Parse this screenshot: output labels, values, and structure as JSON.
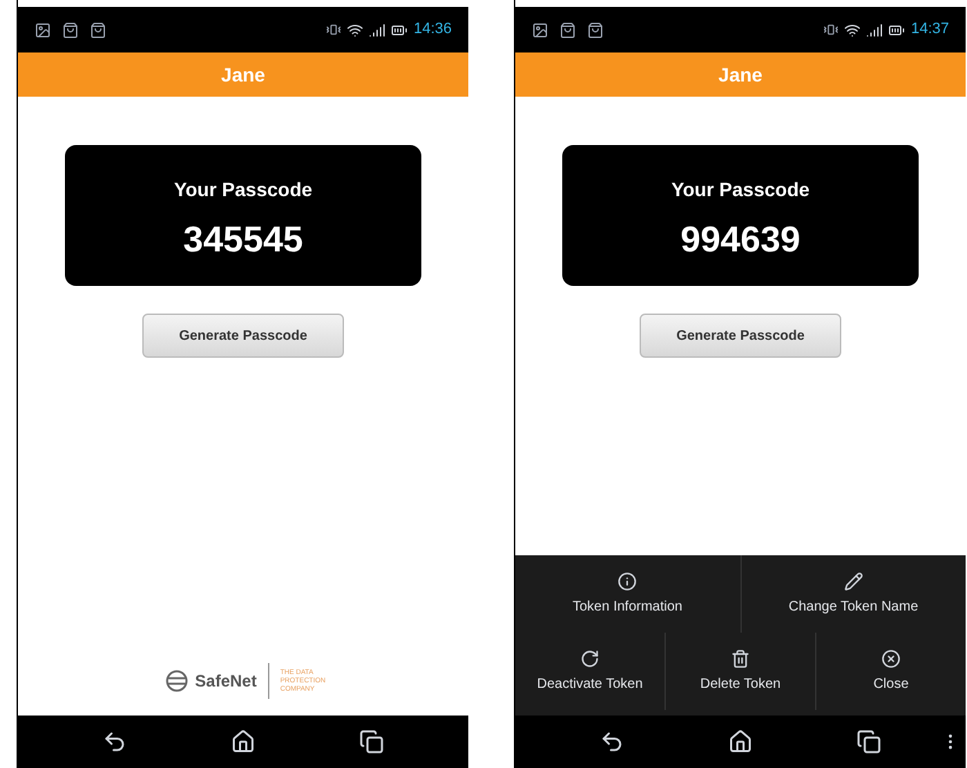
{
  "phones": [
    {
      "status_time": "14:36",
      "title": "Jane",
      "passcode_label": "Your Passcode",
      "passcode": "345545",
      "button": "Generate Passcode",
      "logo": {
        "name": "SafeNet",
        "tagline": "THE DATA PROTECTION COMPANY"
      },
      "overflow": false
    },
    {
      "status_time": "14:37",
      "title": "Jane",
      "passcode_label": "Your Passcode",
      "passcode": "994639",
      "button": "Generate Passcode",
      "overflow": true,
      "menu": [
        [
          {
            "kind": "info",
            "label": "Token Information"
          },
          {
            "kind": "edit",
            "label": "Change Token Name"
          }
        ],
        [
          {
            "kind": "refresh",
            "label": "Deactivate Token"
          },
          {
            "kind": "delete",
            "label": "Delete Token"
          },
          {
            "kind": "close",
            "label": "Close"
          }
        ]
      ]
    }
  ]
}
